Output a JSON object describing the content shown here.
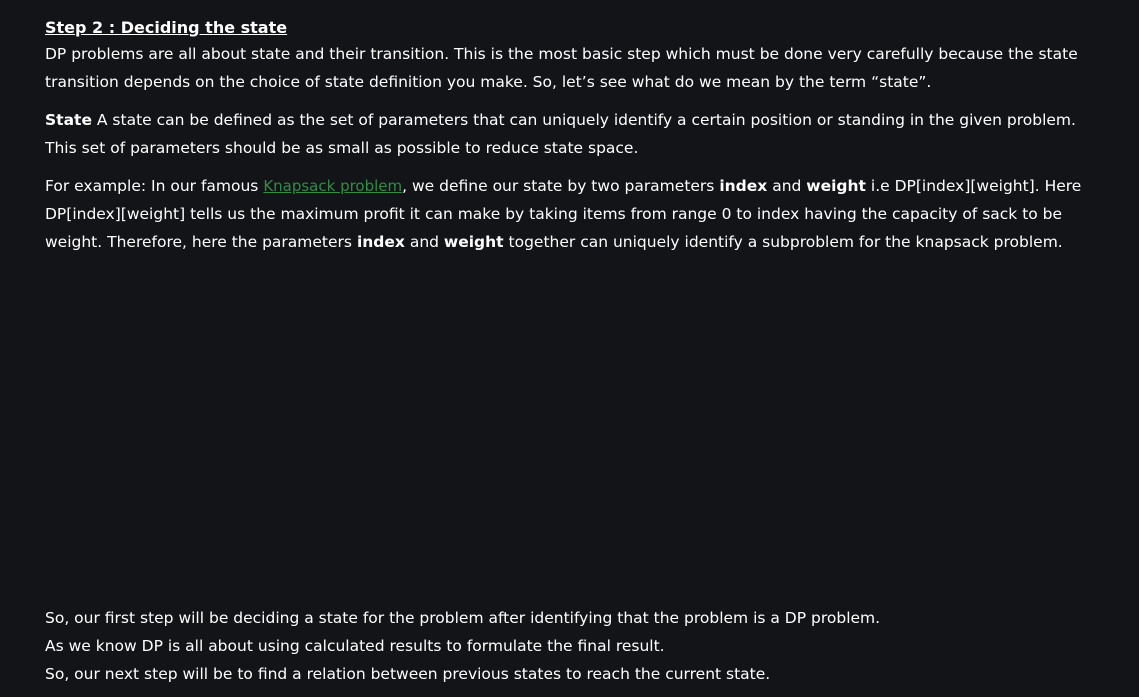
{
  "heading": "Step 2 : Deciding the state",
  "para1": "DP problems are all about state and their transition. This is the most basic step which must be done very carefully because the state transition depends on the choice of state definition you make. So, let’s see what do we mean by the term “state”.",
  "para2": {
    "term": "State",
    "text": " A state can be defined as the set of parameters that can uniquely identify a certain position or standing in the given problem. This set of parameters should be as small as possible to reduce state space."
  },
  "para3": {
    "t1": "For example: In our famous ",
    "link": "Knapsack problem",
    "t2": ", we define our state by two parameters ",
    "b1": "index",
    "t3": " and ",
    "b2": "weight",
    "t4": " i.e DP[index][weight]. Here DP[index][weight] tells us the maximum profit it can make by taking items from range 0 to index having the capacity of sack to be weight. Therefore, here the parameters ",
    "b3": "index",
    "t5": " and ",
    "b4": "weight",
    "t6": " together can uniquely identify a subproblem for the knapsack problem."
  },
  "bottom": {
    "line1": "So, our first step will be deciding a state for the problem after identifying that the problem is a DP problem.",
    "line2": "As we know DP is all about using calculated results to formulate the final result.",
    "line3": "So, our next step will be to find a relation between previous states to reach the current state."
  },
  "colors": {
    "background": "#131417",
    "text": "#ffffff",
    "link": "#2f8d46"
  }
}
